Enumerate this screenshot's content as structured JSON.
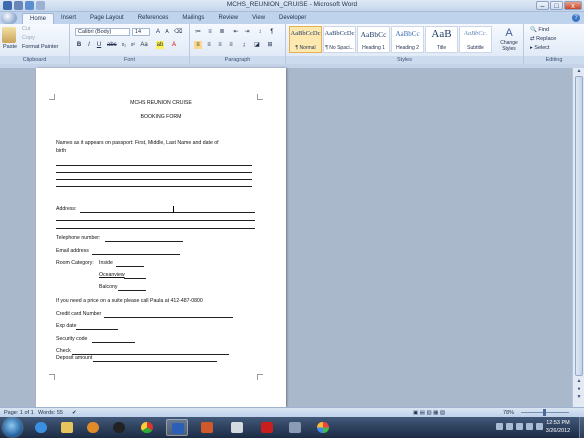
{
  "window": {
    "title": "MCHS_REUNION_CRUISE - Microsoft Word",
    "controls": {
      "minimize": "–",
      "maximize": "□",
      "close": "x"
    }
  },
  "tabs": [
    "Home",
    "Insert",
    "Page Layout",
    "References",
    "Mailings",
    "Review",
    "View",
    "Developer"
  ],
  "active_tab": "Home",
  "ribbon": {
    "clipboard": {
      "paste": "Paste",
      "cut": "Cut",
      "copy": "Copy",
      "format_painter": "Format Painter",
      "label": "Clipboard"
    },
    "font": {
      "font_name": "Calibri (Body)",
      "font_size": "14",
      "bold": "B",
      "italic": "I",
      "underline": "U",
      "label": "Font"
    },
    "paragraph": {
      "label": "Paragraph"
    },
    "styles": {
      "label": "Styles",
      "tiles": [
        {
          "sample": "AaBbCcDc",
          "name": "¶ Normal"
        },
        {
          "sample": "AaBbCcDc",
          "name": "¶ No Spaci..."
        },
        {
          "sample": "AaBbCc",
          "name": "Heading 1"
        },
        {
          "sample": "AaBbCc",
          "name": "Heading 2"
        },
        {
          "sample": "AaB",
          "name": "Title"
        },
        {
          "sample": "AaBbCc.",
          "name": "Subtitle"
        }
      ],
      "change_styles": "Change Styles"
    },
    "editing": {
      "label": "Editing",
      "find": "Find",
      "replace": "Replace",
      "select": "Select"
    }
  },
  "document": {
    "heading1": "MCHS REUNION CRUISE",
    "heading2": "BOOKING FORM",
    "names_prompt_1": "Names as it appears on passport:  First, Middle, Last Name  and date of",
    "names_prompt_2": "birth",
    "address": "Address:",
    "telephone": "Telephone number:",
    "email": "Email address",
    "room_category": "Room Category:",
    "room_inside": "Inside",
    "room_oceanview": "Oceanview",
    "room_balcony": "Balcony",
    "suite_note": "If you need a price on a suite please call Paula at 412-487-0800",
    "credit_card": "Credit card Number",
    "exp_date": "Exp date",
    "security_code": "Security code",
    "check": "Check",
    "deposit": "Deposit amount"
  },
  "status_bar": {
    "page": "Page: 1 of 1",
    "words": "Words: 55",
    "zoom": "78%"
  },
  "taskbar": {
    "time": "12:53 PM",
    "date": "3/26/2012"
  }
}
